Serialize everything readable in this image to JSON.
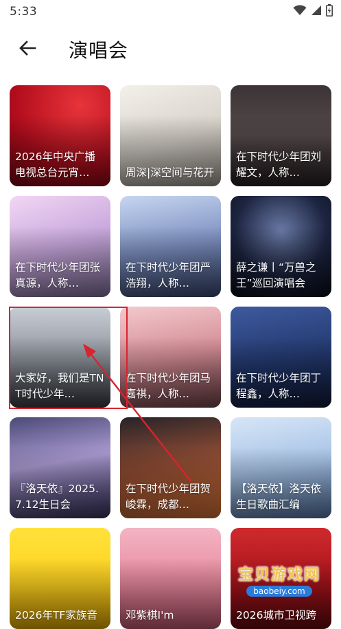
{
  "status_bar": {
    "time": "5:33"
  },
  "header": {
    "title": "演唱会"
  },
  "cards": [
    {
      "title": "2026年中央广播电视总台元宵…"
    },
    {
      "title": "周深|深空间与花开"
    },
    {
      "title": "在下时代少年团刘耀文，人称…"
    },
    {
      "title": "在下时代少年团张真源，人称…"
    },
    {
      "title": "在下时代少年团严浩翔，人称…"
    },
    {
      "title": "薛之谦丨“万兽之王”巡回演唱会"
    },
    {
      "title": "大家好，我们是TNT时代少年…"
    },
    {
      "title": "在下时代少年团马嘉祺，人称…"
    },
    {
      "title": "在下时代少年团丁程鑫，人称…"
    },
    {
      "title": "『洛天依』2025.7.12生日会"
    },
    {
      "title": "在下时代少年团贺峻霖，成都…"
    },
    {
      "title": "【洛天依】洛天依生日歌曲汇编"
    },
    {
      "title": "2026年TF家族音"
    },
    {
      "title": "邓紫棋I'm"
    },
    {
      "title": "2026城市卫视跨"
    }
  ],
  "watermark": {
    "main": "宝贝游戏网",
    "sub": "baobeiy.com"
  },
  "colors": {
    "annotation": "#d9232e"
  },
  "icons": {
    "back": "arrow-left-icon",
    "wifi": "wifi-icon",
    "signal": "signal-icon",
    "battery": "battery-icon"
  }
}
